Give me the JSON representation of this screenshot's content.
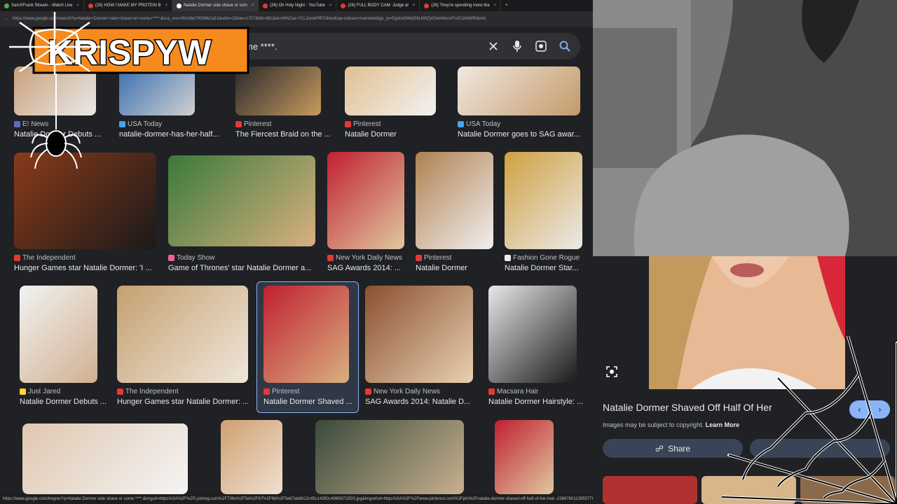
{
  "tabs": [
    {
      "label": "SamXFrank Stream - Watch Live",
      "color": "#4caf50"
    },
    {
      "label": "(26) HOW I MAKE MY PROTEIN B",
      "color": "#e53935"
    },
    {
      "label": "Natalie Dormer side shave or som",
      "color": "#ffffff"
    },
    {
      "label": "(26) Oh Holy Night - YouTube",
      "color": "#e53935"
    },
    {
      "label": "(26) FULL BODY CAM: Judge al",
      "color": "#e53935"
    },
    {
      "label": "(26) They're spending more tha",
      "color": "#e53935"
    }
  ],
  "address": {
    "url": "https://www.google.com/search?q=Natalie+Dormer+side+shave+or+some+****.&sca_esv=0b1bbd70589b2a31&udm=2&biw=1707&bih=881&ei=HfACae-YCL2smkPfPC8Aw&oq=zohran+mamdani&gs_lp=Egdnd3Mtd2l6LWltZyIOem9ocmFuIG1hbWRhbmk"
  },
  "search": {
    "query": "me ****."
  },
  "logo": {
    "text": "KRISPYW"
  },
  "results": [
    {
      "source": "E! News",
      "title": "Natalie Dormer Debuts ...",
      "iconColor": "#5c6bc0"
    },
    {
      "source": "USA Today",
      "title": "natalie-dormer-has-her-half...",
      "iconColor": "#42a5f5"
    },
    {
      "source": "Pinterest",
      "title": "The Fiercest Braid on the ...",
      "iconColor": "#e53935"
    },
    {
      "source": "Pinterest",
      "title": "Natalie Dormer",
      "iconColor": "#e53935"
    },
    {
      "source": "USA Today",
      "title": "Natalie Dormer goes to SAG awar...",
      "iconColor": "#42a5f5"
    },
    {
      "source": "The Independent",
      "title": "Hunger Games star Natalie Dormer: 'I ...",
      "iconColor": "#e53935"
    },
    {
      "source": "Today Show",
      "title": "Game of Thrones' star Natalie Dormer a...",
      "iconColor": "#f06292"
    },
    {
      "source": "New York Daily News",
      "title": "SAG Awards 2014: ...",
      "iconColor": "#e53935"
    },
    {
      "source": "Pinterest",
      "title": "Natalie Dormer",
      "iconColor": "#e53935"
    },
    {
      "source": "Fashion Gone Rogue",
      "title": "Natalie Dormer Star...",
      "iconColor": "#eeeeee"
    },
    {
      "source": "Just Jared",
      "title": "Natalie Dormer Debuts ...",
      "iconColor": "#fdd835"
    },
    {
      "source": "The Independent",
      "title": "Hunger Games star Natalie Dormer: ...",
      "iconColor": "#e53935"
    },
    {
      "source": "Pinterest",
      "title": "Natalie Dormer Shaved ...",
      "iconColor": "#e53935"
    },
    {
      "source": "New York Daily News",
      "title": "SAG Awards 2014: Natalie D...",
      "iconColor": "#e53935"
    },
    {
      "source": "Macsara Hair",
      "title": "Natalie Dormer Hairstyle: ...",
      "iconColor": "#e53935"
    }
  ],
  "statusbar": {
    "text": "https://www.google.com/imgres?q=Natalie Dormer side shave or some ****.&imgurl=https%3A%2F%2Fi.pinimg.com%2F736x%2F5e%2F67%2F8b%2F5e67ab6812c45c143ff2c49656715f20.jpg&imgrefurl=https%3A%2F%2Fwww.pinterest.com%2Fpin%2Fnatalie-dormer-shaved-off-half-of-her-hair--239676011395577625%2F&docid=dTPMxdTlns"
  },
  "preview": {
    "title": "Natalie Dormer Shaved Off Half Of Her",
    "copyright": "Images may be subject to copyright.",
    "learn_more": "Learn More",
    "share_label": "Share"
  }
}
